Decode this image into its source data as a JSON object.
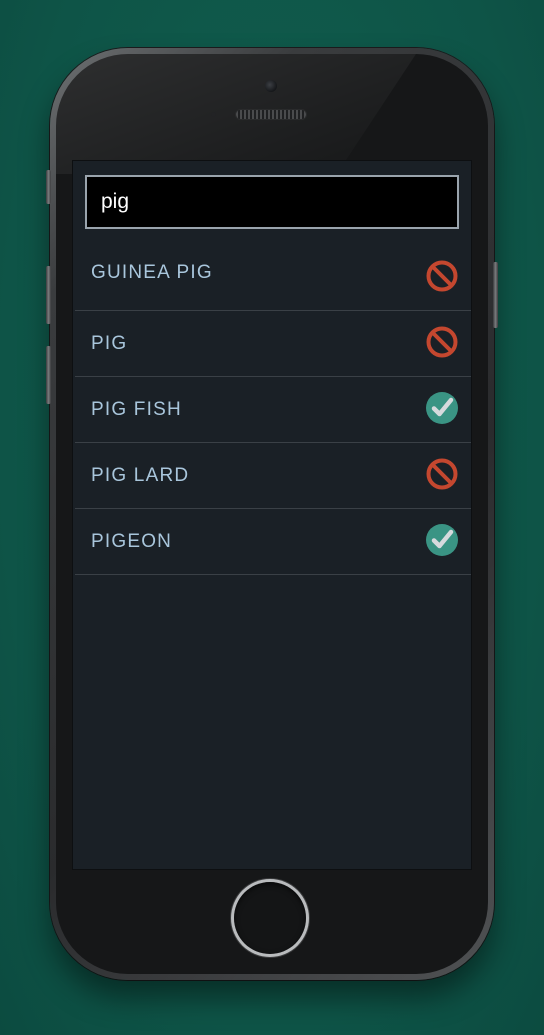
{
  "search": {
    "value": "pig"
  },
  "results": [
    {
      "label": "GUINEA PIG",
      "status": "forbidden",
      "icon": "forbidden-icon"
    },
    {
      "label": "PIG",
      "status": "forbidden",
      "icon": "forbidden-icon"
    },
    {
      "label": "PIG FISH",
      "status": "allowed",
      "icon": "check-icon"
    },
    {
      "label": "PIG LARD",
      "status": "forbidden",
      "icon": "forbidden-icon"
    },
    {
      "label": "PIGEON",
      "status": "allowed",
      "icon": "check-icon"
    }
  ],
  "colors": {
    "background": "#0f5a4d",
    "screen": "#1a2026",
    "label": "#a9c6dc",
    "forbidden": "#c4472f",
    "allowed_bg": "#3a9484",
    "allowed_mark": "#d6dadd",
    "divider": "#3a4046"
  }
}
